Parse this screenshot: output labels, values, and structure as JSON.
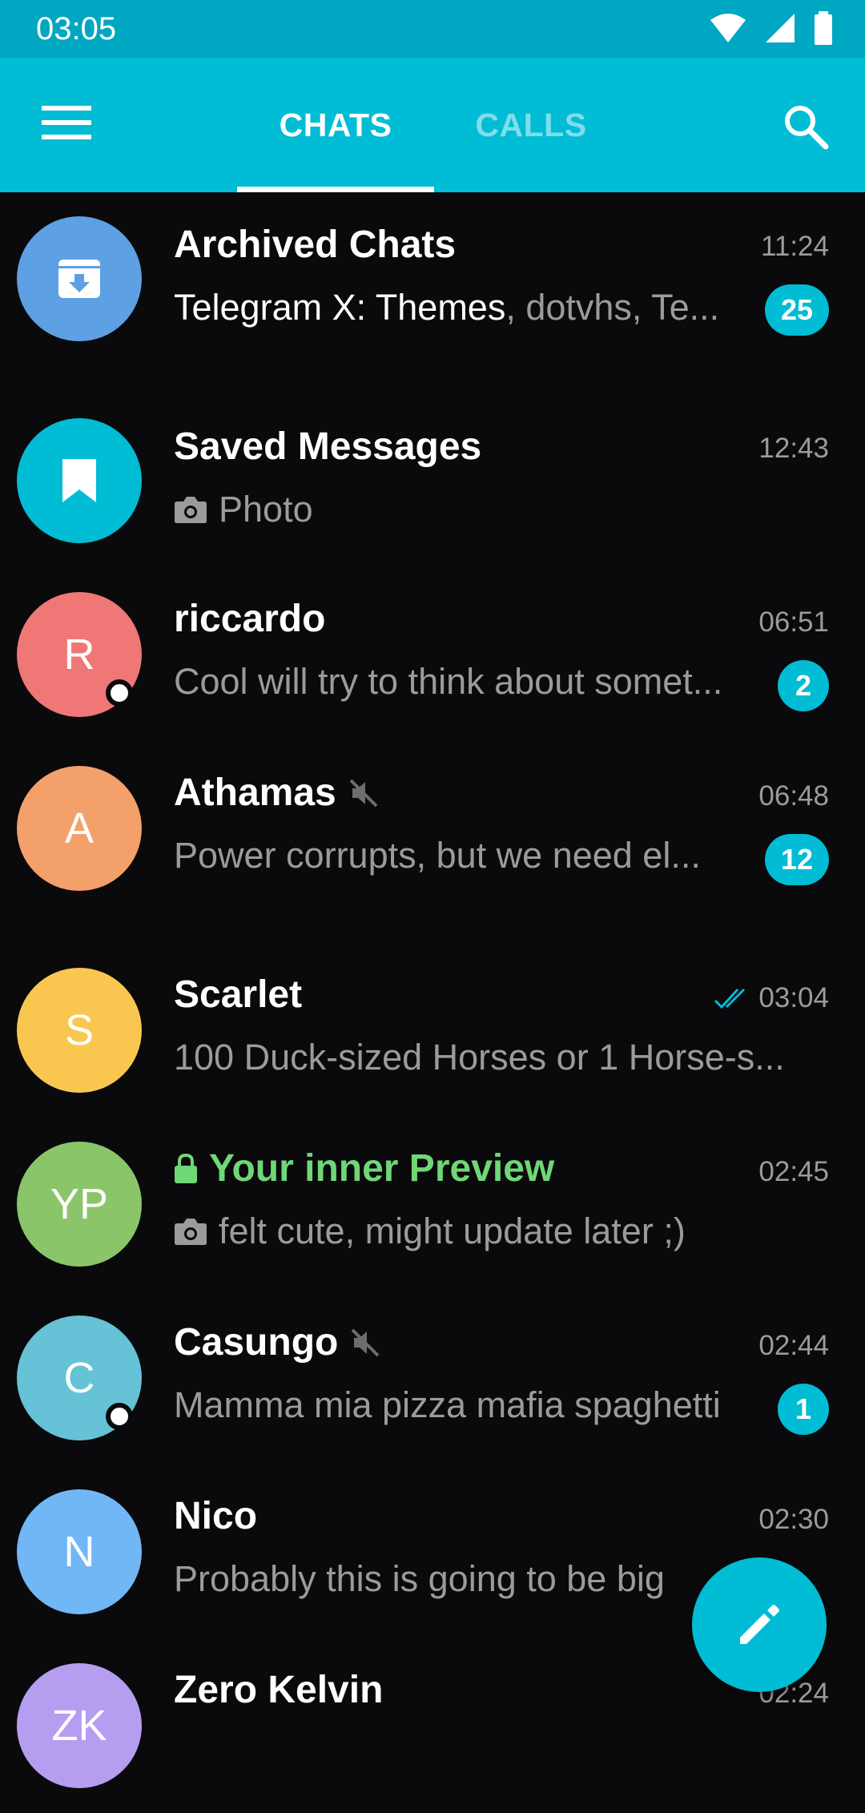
{
  "status_bar": {
    "time": "03:05"
  },
  "app_bar": {
    "tabs": [
      {
        "label": "CHATS",
        "active": true
      },
      {
        "label": "CALLS",
        "active": false
      }
    ]
  },
  "accent_color": "#00bcd4",
  "chats": [
    {
      "name": "Archived Chats",
      "time": "11:24",
      "preview_highlight": "Telegram X: Themes",
      "preview_rest": ", dotvhs, Te...",
      "badge": "25",
      "avatar_color": "#5da0e3",
      "avatar_icon": "archive-icon"
    },
    {
      "name": "Saved Messages",
      "time": "12:43",
      "preview": "Photo",
      "preview_icon": "camera-icon",
      "avatar_color": "#00bcd4",
      "avatar_icon": "bookmark-icon"
    },
    {
      "name": "riccardo",
      "initials": "R",
      "time": "06:51",
      "preview": "Cool will try to think about somet...",
      "badge": "2",
      "online": true,
      "avatar_color": "#ef7776"
    },
    {
      "name": "Athamas",
      "initials": "A",
      "time": "06:48",
      "preview": "Power corrupts, but we need el...",
      "badge": "12",
      "muted": true,
      "avatar_color": "#f4a06a"
    },
    {
      "name": "Scarlet",
      "initials": "S",
      "time": "03:04",
      "preview": "100 Duck-sized Horses or 1 Horse-s...",
      "read_receipt": "double-check-icon",
      "avatar_color": "#f9c74f"
    },
    {
      "name": "Your inner Preview",
      "initials": "YP",
      "time": "02:45",
      "preview": "felt cute, might update later ;)",
      "preview_icon": "camera-icon",
      "secret": true,
      "avatar_color": "#8bc56a"
    },
    {
      "name": "Casungo",
      "initials": "C",
      "time": "02:44",
      "preview": "Mamma mia pizza mafia spaghetti",
      "badge": "1",
      "muted": true,
      "online": true,
      "avatar_color": "#66c2d6"
    },
    {
      "name": "Nico",
      "initials": "N",
      "time": "02:30",
      "preview": "Probably this is going to be big",
      "avatar_color": "#72b7f5"
    },
    {
      "name": "Zero Kelvin",
      "initials": "ZK",
      "time": "02:24",
      "avatar_color": "#b59df0"
    }
  ]
}
